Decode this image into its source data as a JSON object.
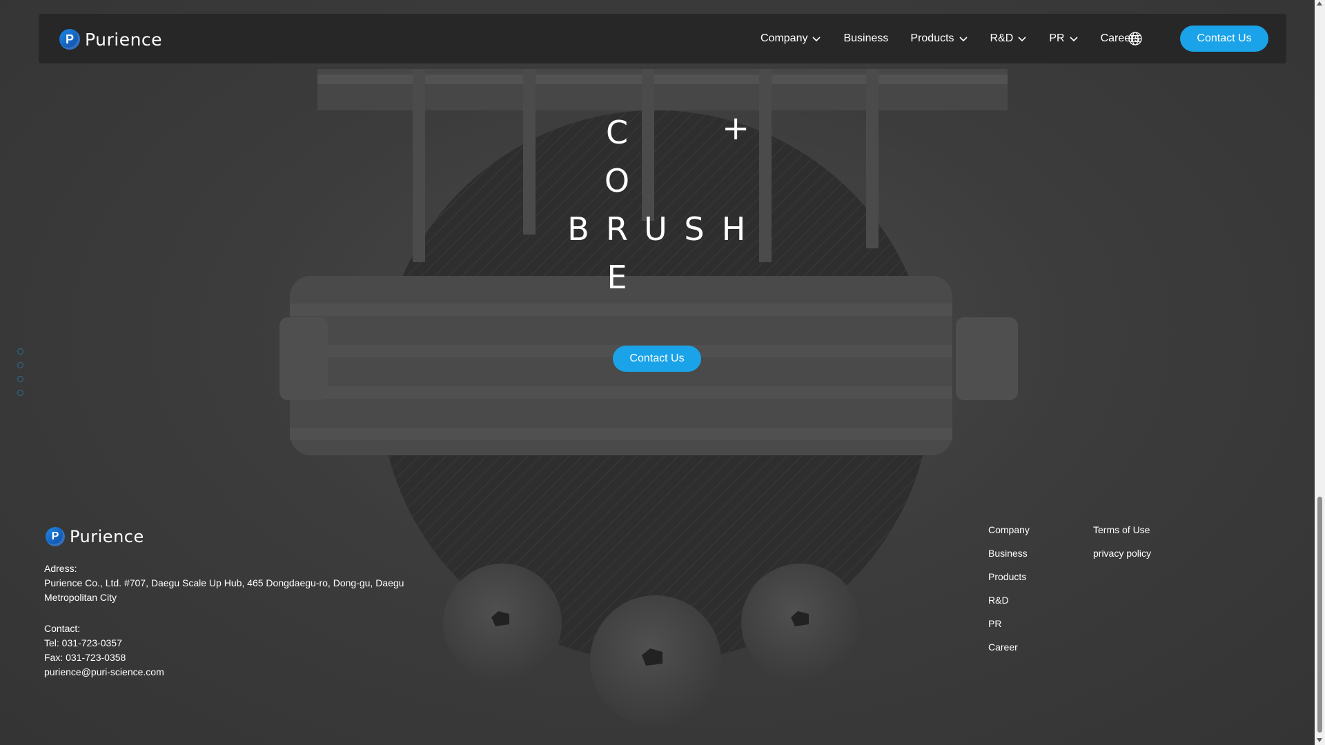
{
  "brand": {
    "name": "Purience",
    "logo_icon": "purience-logo-mark",
    "accent_color": "#1aa3e8"
  },
  "nav": {
    "items": [
      {
        "label": "Company",
        "has_dropdown": true
      },
      {
        "label": "Business",
        "has_dropdown": false
      },
      {
        "label": "Products",
        "has_dropdown": true
      },
      {
        "label": "R&D",
        "has_dropdown": true
      },
      {
        "label": "PR",
        "has_dropdown": true
      },
      {
        "label": "Careers",
        "has_dropdown": false
      }
    ],
    "language_icon": "globe-icon",
    "contact_label": "Contact Us"
  },
  "hero": {
    "word_vertical": [
      "C",
      "O",
      "R",
      "E"
    ],
    "word_horizontal": [
      "B",
      "R",
      "U",
      "S",
      "H"
    ],
    "plus": "+",
    "contact_label": "Contact Us"
  },
  "pager": {
    "count": 4
  },
  "footer": {
    "address_label": "Adress:",
    "address": "Purience Co., Ltd. #707, Daegu Scale Up Hub, 465 Dongdaegu-ro, Dong-gu, Daegu Metropolitan City",
    "contact_label": "Contact:",
    "tel": "Tel: 031-723-0357",
    "fax": "Fax: 031-723-0358",
    "email": "purience@puri-science.com",
    "links_col1": [
      "Company",
      "Business",
      "Products",
      "R&D",
      "PR",
      "Career"
    ],
    "links_col2": [
      "Terms of Use",
      "privacy policy"
    ]
  }
}
